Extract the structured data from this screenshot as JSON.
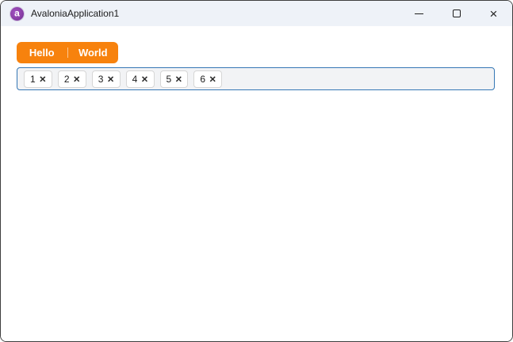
{
  "window": {
    "title": "AvaloniaApplication1",
    "icon_letter": "a",
    "close_glyph": "×"
  },
  "tabs": [
    {
      "label": "Hello"
    },
    {
      "label": "World"
    }
  ],
  "chips": {
    "remove_glyph": "×",
    "items": [
      {
        "label": "1"
      },
      {
        "label": "2"
      },
      {
        "label": "3"
      },
      {
        "label": "4"
      },
      {
        "label": "5"
      },
      {
        "label": "6"
      }
    ]
  },
  "colors": {
    "accent_orange": "#f7820d",
    "focus_border": "#3577b5",
    "titlebar_bg": "#eef2f8",
    "window_border": "#3e3e3e",
    "chip_bg": "#ffffff",
    "chipbox_bg": "#f2f3f5"
  }
}
